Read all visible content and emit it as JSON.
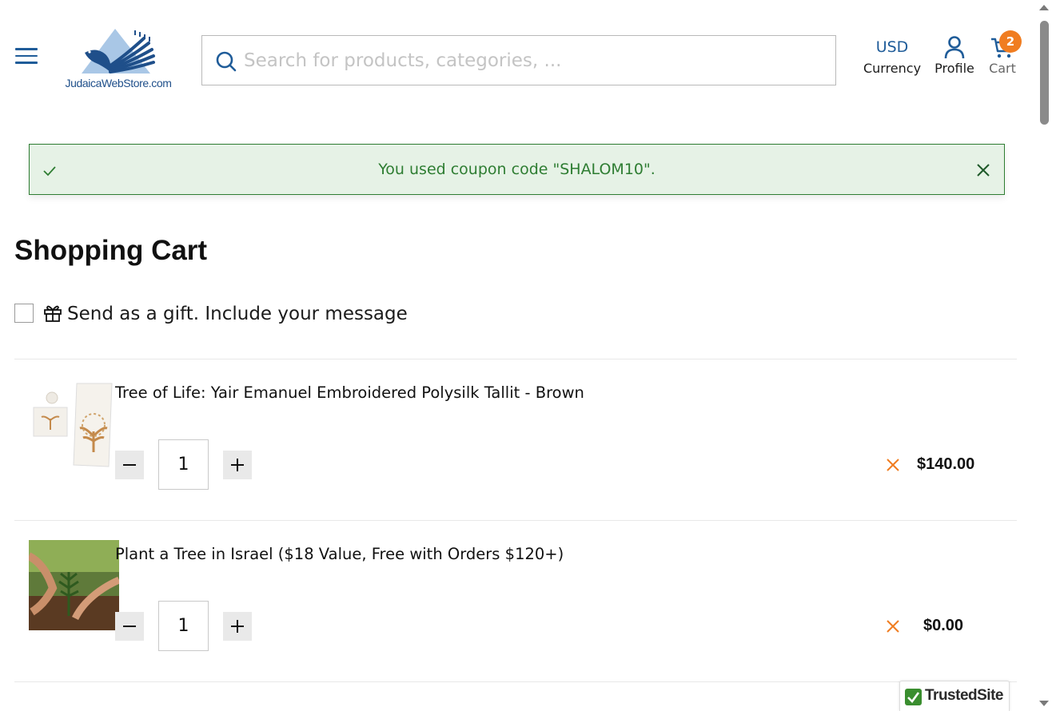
{
  "header": {
    "logo_text": "JudaicaWebStore.com",
    "search_placeholder": "Search for products, categories, ...",
    "currency": {
      "value": "USD",
      "label": "Currency"
    },
    "profile": {
      "label": "Profile"
    },
    "cart": {
      "label": "Cart",
      "count": "2"
    }
  },
  "alert": {
    "message": "You used coupon code \"SHALOM10\"."
  },
  "page_title": "Shopping Cart",
  "gift": {
    "label": "Send as a gift. Include your message",
    "checked": false
  },
  "cart_items": [
    {
      "name": "Tree of Life: Yair Emanuel Embroidered Polysilk Tallit - Brown",
      "quantity": "1",
      "price": "$140.00"
    },
    {
      "name": "Plant a Tree in Israel ($18 Value, Free with Orders $120+)",
      "quantity": "1",
      "price": "$0.00"
    }
  ],
  "trusted_badge": "TrustedSite",
  "colors": {
    "brand_blue": "#1f5c99",
    "accent_orange": "#f07d21",
    "success_green": "#2e7d32",
    "success_bg": "#e6f2e6"
  }
}
